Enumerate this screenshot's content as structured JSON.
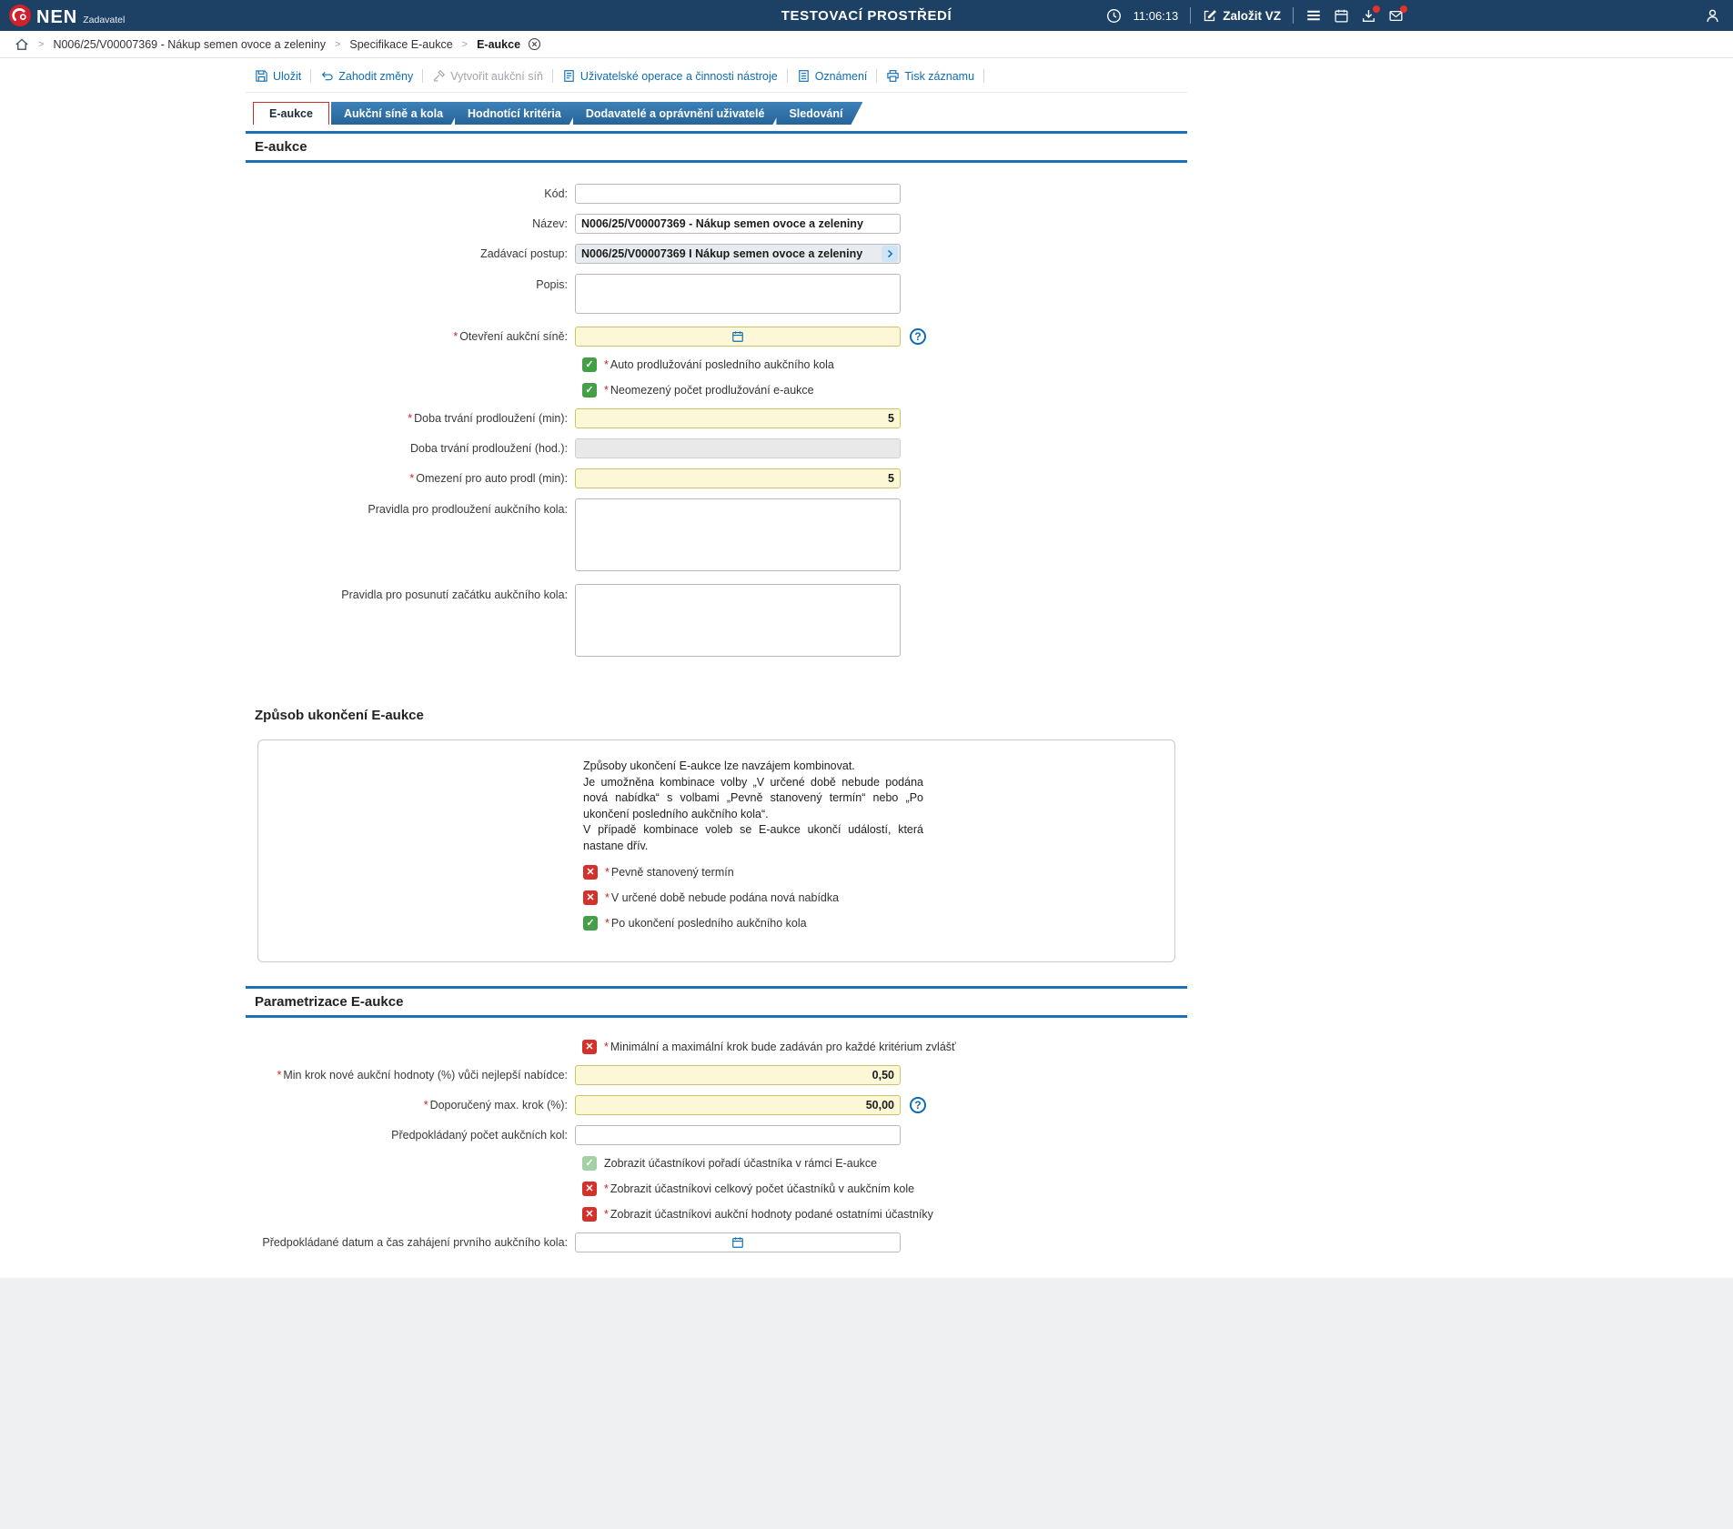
{
  "ui": {
    "required_marker": "*",
    "check_glyph": "✓",
    "cross_glyph": "✕",
    "help_glyph": "?",
    "breadcrumb_separator": ">",
    "colors": {
      "header_bg": "#1d4164",
      "accent_red": "#cc2028",
      "tab_blue": "#2e74ac",
      "link_blue": "#0d6cb5",
      "section_line_blue": "#1c70b6",
      "required_field_yellow": "#fcf8d7",
      "checkbox_green": "#43a047",
      "checkbox_red": "#d3322c"
    }
  },
  "header": {
    "brand": "NEN",
    "brand_subtitle": "Zadavatel",
    "environment_title": "TESTOVACÍ PROSTŘEDÍ",
    "time": "11:06:13",
    "create_vz_label": "Založit VZ"
  },
  "breadcrumb": {
    "items": [
      "N006/25/V00007369 - Nákup semen ovoce a zeleniny",
      "Specifikace E-aukce",
      "E-aukce"
    ]
  },
  "toolbar": {
    "items": [
      {
        "label": "Uložit",
        "enabled": true
      },
      {
        "label": "Zahodit změny",
        "enabled": true
      },
      {
        "label": "Vytvořit aukční síň",
        "enabled": false
      },
      {
        "label": "Uživatelské operace a činnosti nástroje",
        "enabled": true
      },
      {
        "label": "Oznámení",
        "enabled": true
      },
      {
        "label": "Tisk záznamu",
        "enabled": true
      }
    ]
  },
  "tabs": [
    {
      "label": "E-aukce",
      "active": true
    },
    {
      "label": "Aukční síně a kola",
      "active": false
    },
    {
      "label": "Hodnotící kritéria",
      "active": false
    },
    {
      "label": "Dodavatelé a oprávnění uživatelé",
      "active": false
    },
    {
      "label": "Sledování",
      "active": false
    }
  ],
  "eaukce": {
    "title": "E-aukce",
    "fields": {
      "kod": {
        "label": "Kód:",
        "value": ""
      },
      "nazev": {
        "label": "Název:",
        "value": "N006/25/V00007369 - Nákup semen ovoce a zeleniny"
      },
      "zadavaci_postup": {
        "label": "Zadávací postup:",
        "value": "N006/25/V00007369 I Nákup semen ovoce a zeleniny"
      },
      "popis": {
        "label": "Popis:",
        "value": ""
      },
      "otevreni": {
        "label": "Otevření aukční síně:",
        "date_value": "",
        "time_value": ""
      },
      "auto_prodluzovani": {
        "label": "Auto prodlužování posledního aukčního kola",
        "checked": true
      },
      "neomezeny_pocet": {
        "label": "Neomezený počet prodlužování e-aukce",
        "checked": true
      },
      "doba_min": {
        "label": "Doba trvání prodloužení (min):",
        "value": "5"
      },
      "doba_hod": {
        "label": "Doba trvání prodloužení (hod.):",
        "value": ""
      },
      "omezeni": {
        "label": "Omezení pro auto prodl (min):",
        "value": "5"
      },
      "pravidla_prodlouzeni": {
        "label": "Pravidla pro prodloužení aukčního kola:",
        "value": ""
      },
      "pravidla_posunuti": {
        "label": "Pravidla pro posunutí začátku aukčního kola:",
        "value": ""
      }
    }
  },
  "zpusob": {
    "title": "Způsob ukončení E-aukce",
    "info": [
      "Způsoby ukončení E-aukce lze navzájem kombinovat.",
      "Je umožněna kombinace volby „V určené době nebude podána nová nabídka“ s volbami „Pevně stanovený termín“ nebo „Po ukončení posledního aukčního kola“.",
      "V případě kombinace voleb se E-aukce ukončí událostí, která nastane dřív."
    ],
    "fields": {
      "pevny_termin": {
        "label": "Pevně stanovený termín",
        "checked": false
      },
      "nova_nabidka": {
        "label": "V určené době nebude podána nová nabídka",
        "checked": false
      },
      "po_ukonceni": {
        "label": "Po ukončení posledního aukčního kola",
        "checked": true
      }
    }
  },
  "param": {
    "title": "Parametrizace E-aukce",
    "fields": {
      "krok_zvlast": {
        "label": "Minimální a maximální krok bude zadáván pro každé kritérium zvlášť",
        "checked": false
      },
      "min_krok": {
        "label": "Min krok nové aukční hodnoty (%) vůči nejlepší nabídce:",
        "value": "0,50"
      },
      "max_krok": {
        "label": "Doporučený max. krok (%):",
        "value": "50,00"
      },
      "pocet_kol": {
        "label": "Předpokládaný počet aukčních kol:",
        "value": ""
      },
      "poradi": {
        "label": "Zobrazit účastníkovi pořadí účastníka v rámci E-aukce",
        "checked": true,
        "disabled": true
      },
      "pocet_ucastniku": {
        "label": "Zobrazit účastníkovi celkový počet účastníků v aukčním kole",
        "checked": false
      },
      "hodnoty": {
        "label": "Zobrazit účastníkovi aukční hodnoty podané ostatními účastníky",
        "checked": false
      },
      "datum_zahajeni": {
        "label": "Předpokládané datum a čas zahájení prvního aukčního kola:",
        "date_value": "",
        "time_value": ""
      }
    }
  }
}
